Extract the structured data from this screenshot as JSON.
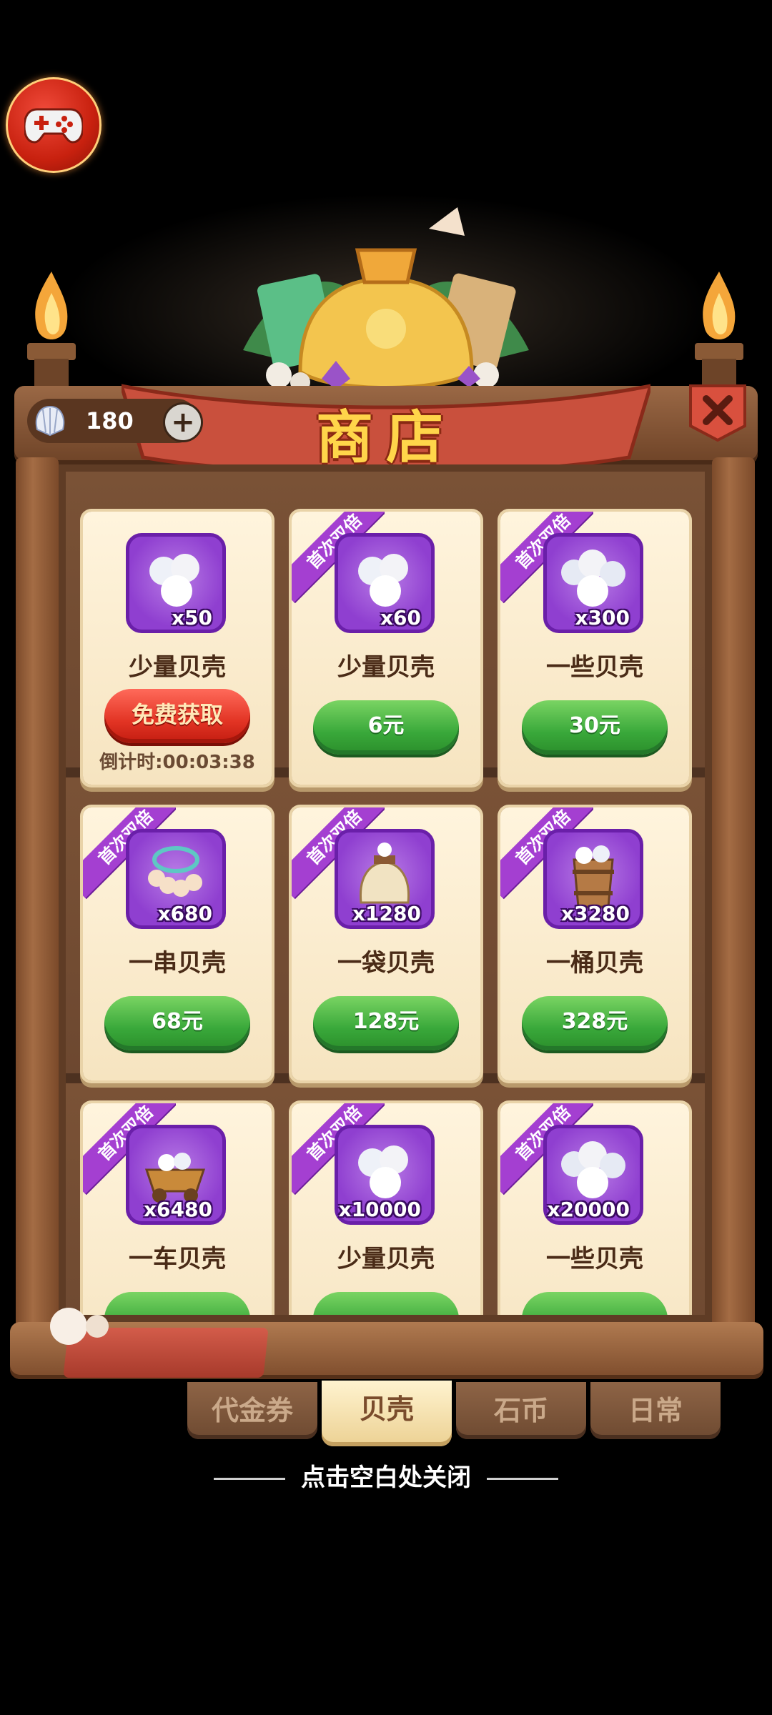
{
  "header": {
    "title": "商店",
    "currency_value": "180"
  },
  "items": [
    {
      "qty": "x50",
      "name": "少量贝壳",
      "action": "免费获取",
      "countdown": "倒计时:00:03:38",
      "badge": ""
    },
    {
      "qty": "x60",
      "name": "少量贝壳",
      "action": "6元",
      "badge": "首次双倍"
    },
    {
      "qty": "x300",
      "name": "一些贝壳",
      "action": "30元",
      "badge": "首次双倍"
    },
    {
      "qty": "x680",
      "name": "一串贝壳",
      "action": "68元",
      "badge": "首次双倍"
    },
    {
      "qty": "x1280",
      "name": "一袋贝壳",
      "action": "128元",
      "badge": "首次双倍"
    },
    {
      "qty": "x3280",
      "name": "一桶贝壳",
      "action": "328元",
      "badge": "首次双倍"
    },
    {
      "qty": "x6480",
      "name": "一车贝壳",
      "action": "",
      "badge": "首次双倍"
    },
    {
      "qty": "x10000",
      "name": "少量贝壳",
      "action": "",
      "badge": "首次双倍"
    },
    {
      "qty": "x20000",
      "name": "一些贝壳",
      "action": "",
      "badge": "首次双倍"
    }
  ],
  "tabs": [
    {
      "label": "代金券",
      "active": false
    },
    {
      "label": "贝壳",
      "active": true
    },
    {
      "label": "石币",
      "active": false
    },
    {
      "label": "日常",
      "active": false
    }
  ],
  "footer": {
    "close_hint": "点击空白处关闭"
  },
  "colors": {
    "buy_green": "#39a83a",
    "free_red": "#e23424",
    "badge_purple": "#a43fd1",
    "title_gold": "#ffd54a"
  }
}
